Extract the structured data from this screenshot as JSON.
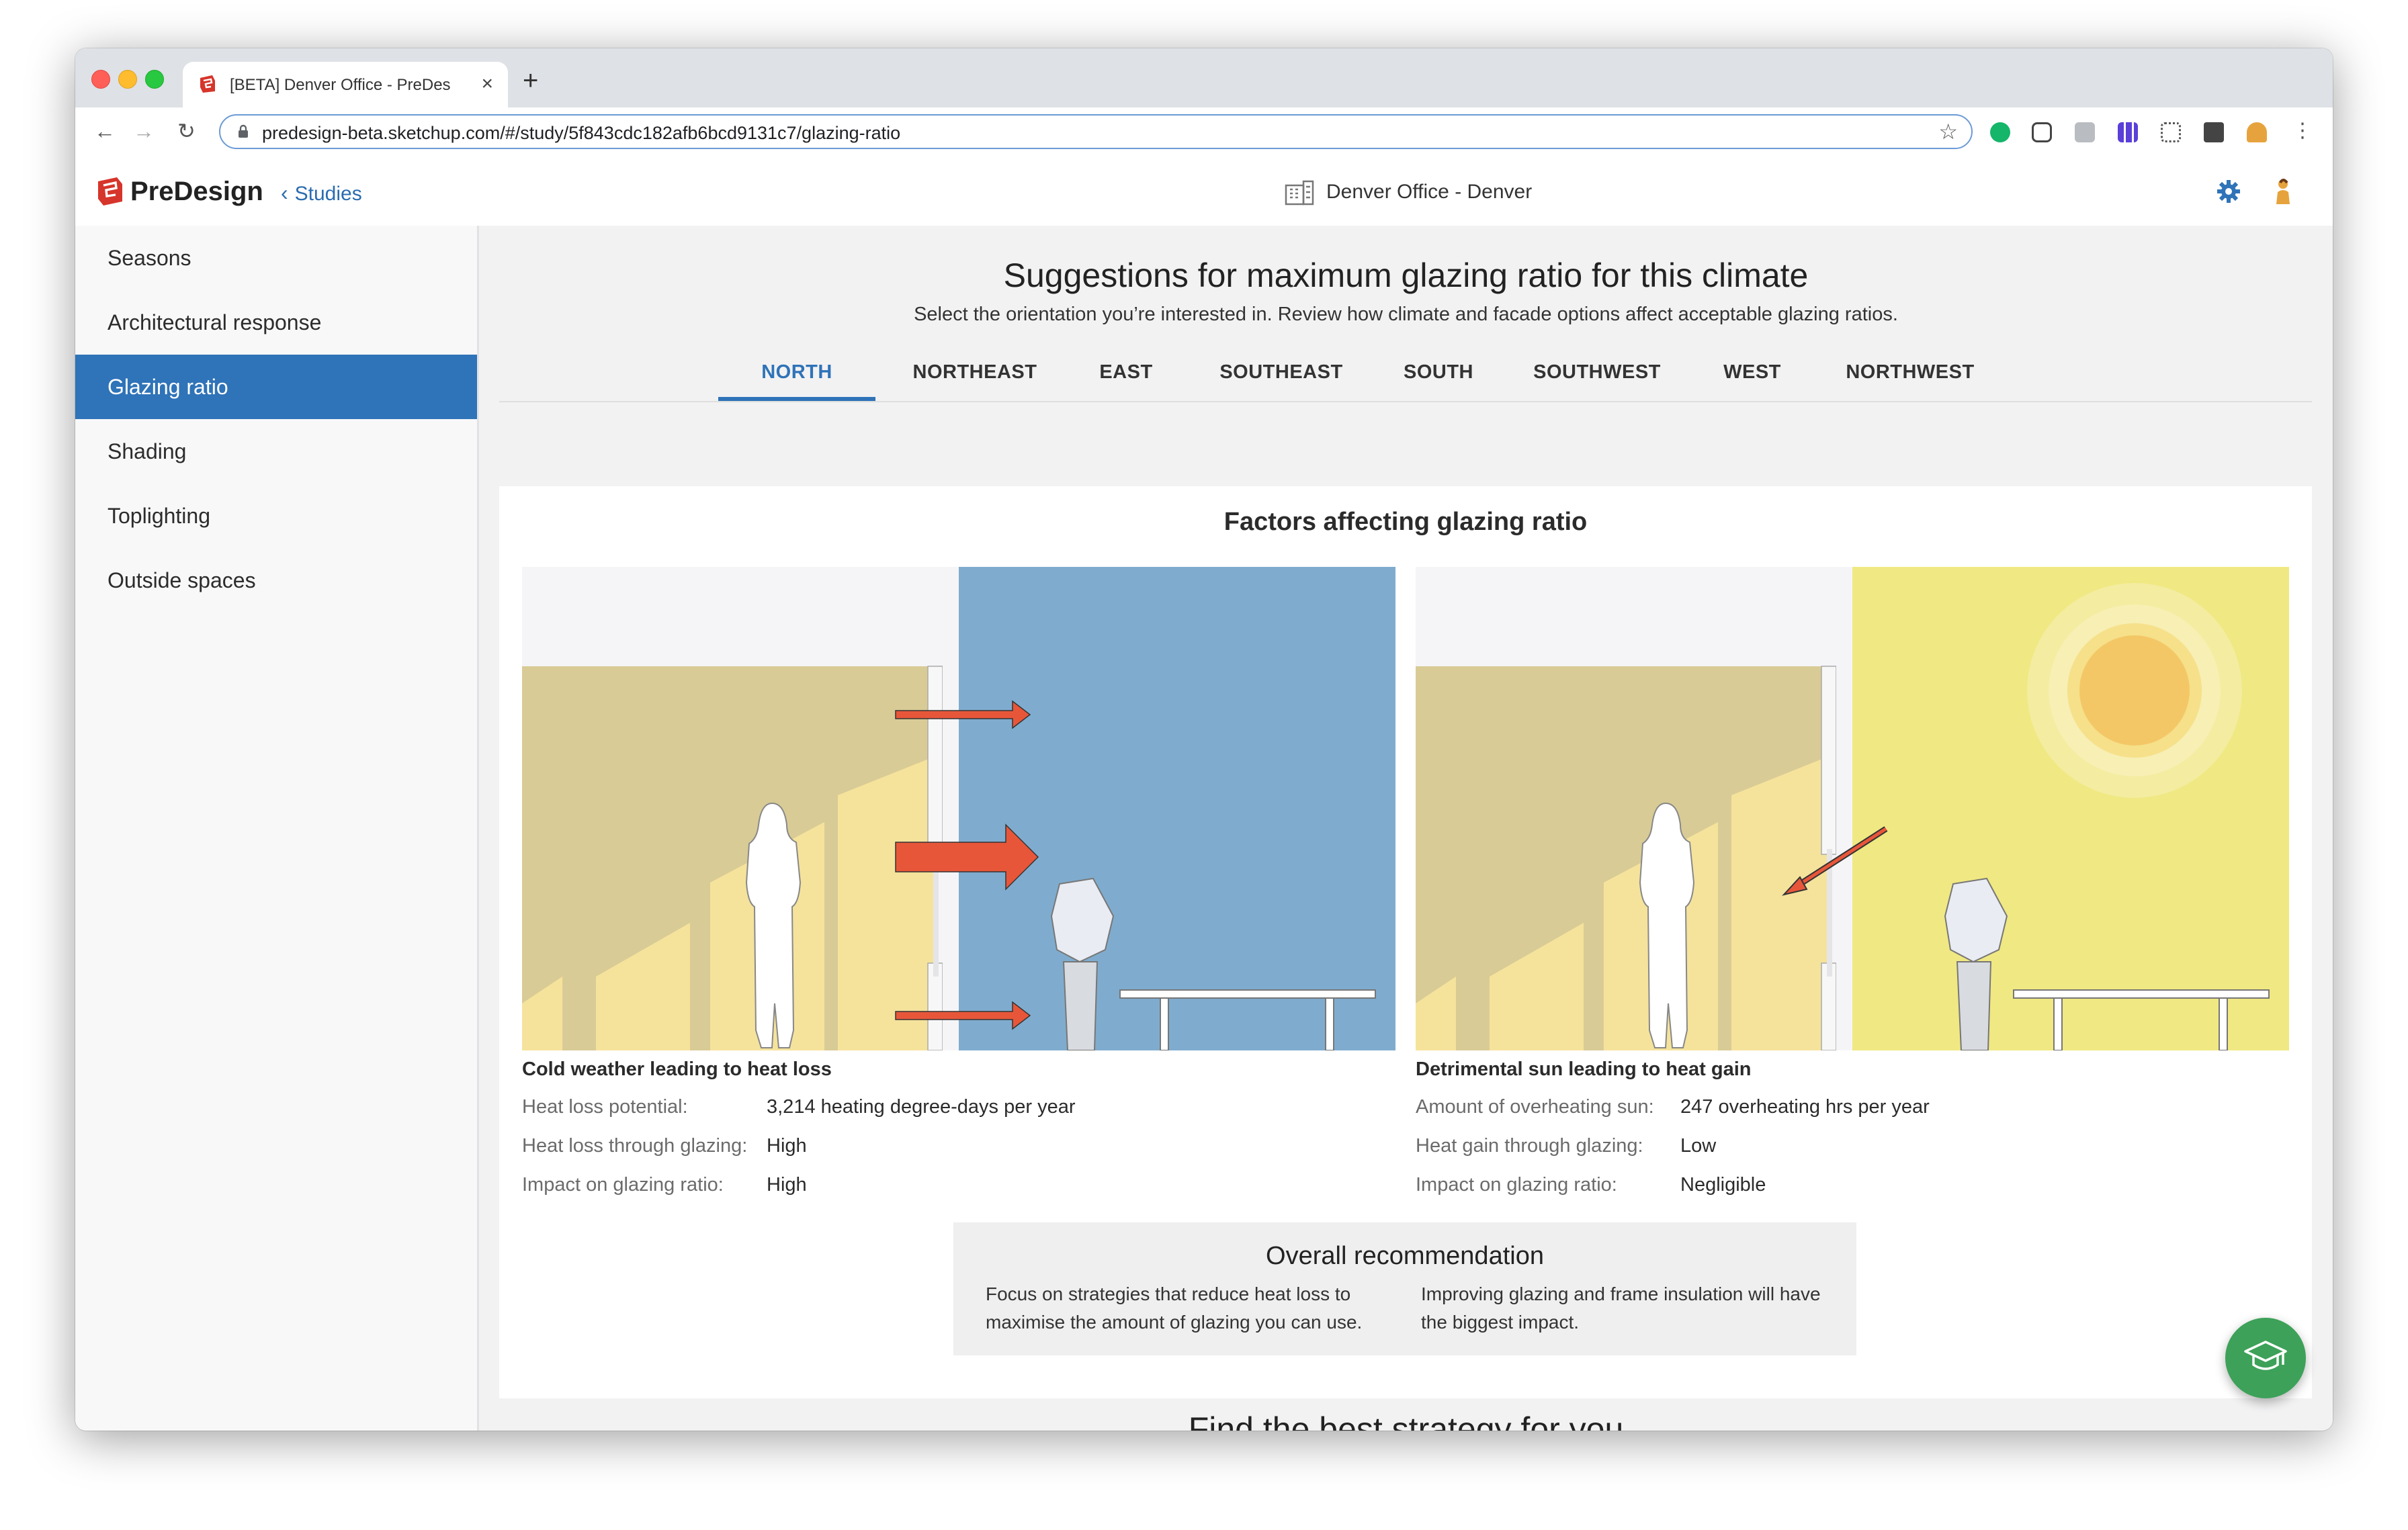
{
  "browser": {
    "tab_title": "[BETA] Denver Office - PreDesign",
    "new_tab_label": "+",
    "url": "predesign-beta.sketchup.com/#/study/5f843cdc182afb6bcd9131c7/glazing-ratio"
  },
  "header": {
    "brand": "PreDesign",
    "back_label": "Studies",
    "project_name": "Denver Office - Denver"
  },
  "sidebar": {
    "items": [
      {
        "label": "Seasons",
        "active": false
      },
      {
        "label": "Architectural response",
        "active": false
      },
      {
        "label": "Glazing ratio",
        "active": true
      },
      {
        "label": "Shading",
        "active": false
      },
      {
        "label": "Toplighting",
        "active": false
      },
      {
        "label": "Outside spaces",
        "active": false
      }
    ]
  },
  "main": {
    "title": "Suggestions for maximum glazing ratio for this climate",
    "subtitle": "Select the orientation you’re interested in. Review how climate and facade options affect acceptable glazing ratios.",
    "orientation_tabs": [
      "NORTH",
      "NORTHEAST",
      "EAST",
      "SOUTHEAST",
      "SOUTH",
      "SOUTHWEST",
      "WEST",
      "NORTHWEST"
    ],
    "active_tab": "NORTH",
    "factors_title": "Factors affecting glazing ratio",
    "factors": [
      {
        "heading": "Cold weather leading to heat loss",
        "rows": [
          {
            "label": "Heat loss potential:",
            "value": "3,214 heating degree-days per year"
          },
          {
            "label": "Heat loss through glazing:",
            "value": "High"
          },
          {
            "label": "Impact on glazing ratio:",
            "value": "High"
          }
        ]
      },
      {
        "heading": "Detrimental sun leading to heat gain",
        "rows": [
          {
            "label": "Amount of overheating sun:",
            "value": "247 overheating hrs per year"
          },
          {
            "label": "Heat gain through glazing:",
            "value": "Low"
          },
          {
            "label": "Impact on glazing ratio:",
            "value": "Negligible"
          }
        ]
      }
    ],
    "recommendation": {
      "title": "Overall recommendation",
      "left": "Focus on strategies that reduce heat loss to maximise the amount of glazing you can use.",
      "right": "Improving glazing and frame insulation will have the biggest impact."
    },
    "next_section_title": "Find the best strategy for you"
  },
  "colors": {
    "accent": "#2f73b8",
    "cold_sky": "#7facce",
    "warm_sky": "#f0e882",
    "interior_wall": "#d9cb95",
    "sunlight_patch": "#f5e39c",
    "arrow": "#e8563a",
    "fab": "#3da159"
  },
  "icons": {
    "back": "chevron-left-icon",
    "building": "building-icon",
    "settings": "gear-icon",
    "help": "graduation-cap-icon"
  }
}
